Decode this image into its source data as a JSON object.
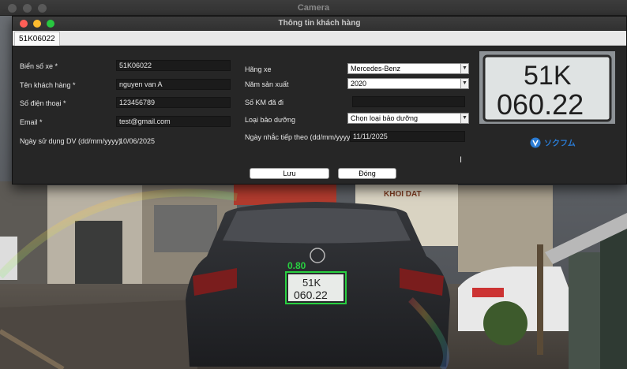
{
  "background_window": {
    "title": "Camera"
  },
  "dialog": {
    "title": "Thông tin khách hàng",
    "tab": "51K06022",
    "left": {
      "plate_label": "Biển số xe *",
      "plate_value": "51K06022",
      "name_label": "Tên khách hàng *",
      "name_value": "nguyen van A",
      "phone_label": "Số điện thoại *",
      "phone_value": "123456789",
      "email_label": "Email *",
      "email_value": "test@gmail.com",
      "date_label": "Ngày sử dụng DV (dd/mm/yyyy)",
      "date_value": "10/06/2025"
    },
    "right": {
      "brand_label": "Hãng xe",
      "brand_value": "Mercedes-Benz",
      "year_label": "Năm sản xuất",
      "year_value": "2020",
      "km_label": "Số KM đã đi",
      "km_value": "",
      "service_label": "Loại bảo dưỡng",
      "service_value": "Chọn loại bảo dưỡng",
      "next_label": "Ngày nhắc tiếp theo (dd/mm/yyyy)",
      "next_value": "11/11/2025"
    },
    "plate_image_text": {
      "line1": "51K",
      "line2": "060.22"
    },
    "logo_text": "ソクフム",
    "buttons": {
      "save": "Lưu",
      "close": "Đóng"
    }
  },
  "scene": {
    "detection_score": "0.80",
    "plate_line1": "51K",
    "plate_line2": "060.22",
    "shop_sign": "KHOI DAT"
  }
}
